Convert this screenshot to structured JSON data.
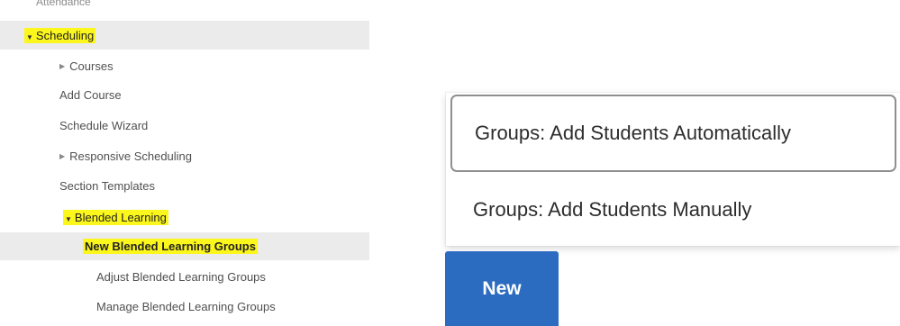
{
  "nav": {
    "cut_off_item": "Attendance",
    "scheduling": {
      "label": "Scheduling",
      "highlighted": true,
      "expanded": true
    },
    "items": [
      {
        "label": "Courses",
        "has_children": true
      },
      {
        "label": "Add Course"
      },
      {
        "label": "Schedule Wizard"
      },
      {
        "label": "Responsive Scheduling",
        "has_children": true
      },
      {
        "label": "Section Templates"
      }
    ],
    "blended_learning": {
      "label": "Blended Learning",
      "highlighted": true,
      "expanded": true,
      "children": [
        {
          "label": "New Blended Learning Groups",
          "selected": true,
          "highlighted": true
        },
        {
          "label": "Adjust Blended Learning Groups"
        },
        {
          "label": "Manage Blended Learning Groups"
        }
      ]
    },
    "highlight_color": "#fbf61c",
    "selected_row_color": "#ebebeb"
  },
  "menu": {
    "options": [
      {
        "label": "Groups: Add Students Automatically",
        "focused": true
      },
      {
        "label": "Groups: Add Students Manually"
      }
    ]
  },
  "new_button": {
    "label": "New",
    "color": "#2c6cc0"
  },
  "icons": {
    "expanded": "caret-down-icon",
    "collapsed": "caret-right-icon"
  }
}
